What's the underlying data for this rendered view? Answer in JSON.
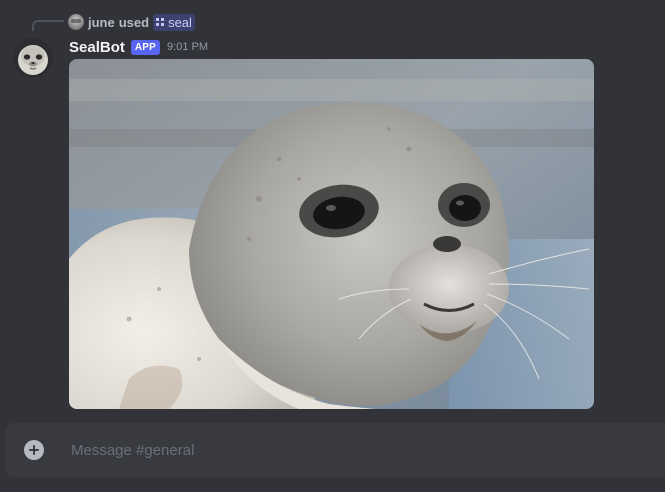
{
  "reply": {
    "user": "june",
    "action": "used",
    "command": "seal"
  },
  "message": {
    "author": "SealBot",
    "badge": "APP",
    "time": "9:01 PM",
    "image_subject": "seal-photo"
  },
  "composer": {
    "placeholder": "Message #general"
  },
  "colors": {
    "background": "#313338",
    "composer": "#383a40",
    "badge": "#5865f2",
    "username": "#f2f3f5",
    "muted": "#949ba4"
  },
  "icons": {
    "command": "slash-command-icon",
    "attach": "plus-circle-icon"
  }
}
